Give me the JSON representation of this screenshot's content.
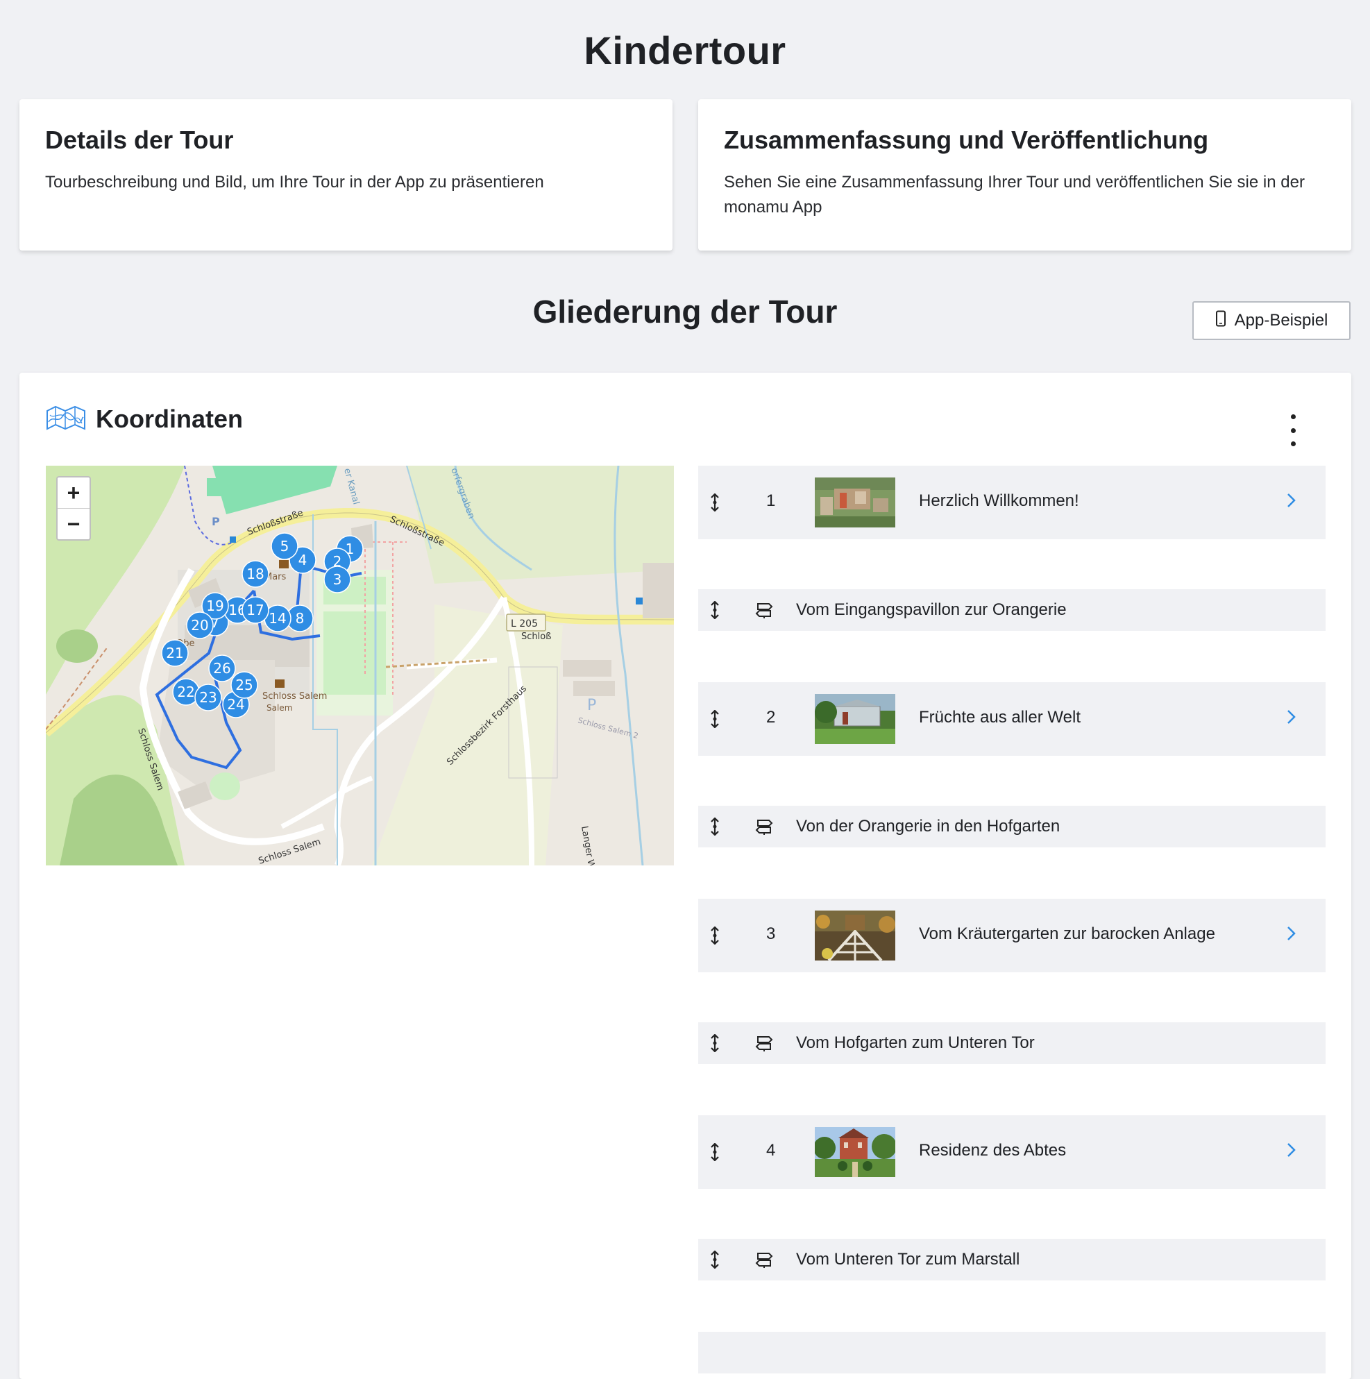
{
  "page": {
    "title": "Kindertour"
  },
  "cards": {
    "details": {
      "title": "Details der Tour",
      "description": "Tourbeschreibung und Bild, um Ihre Tour in der App zu präsentieren"
    },
    "summary": {
      "title": "Zusammenfassung und Veröffentlichung",
      "description": "Sehen Sie eine Zusammenfassung Ihrer Tour und veröffentlichen Sie sie in der monamu App"
    }
  },
  "outline": {
    "title": "Gliederung der Tour",
    "app_example_button": "App-Beispiel",
    "coordinates_title": "Koordinaten"
  },
  "map": {
    "zoom_in": "+",
    "zoom_out": "−",
    "street_labels": [
      "Schloßstraße",
      "Schloßstraße",
      "L 205",
      "Schloß",
      "Schlossbezirk Forsthaus",
      "Schloss Salem",
      "Schloss Salem",
      "Schloss Salem",
      "Langer W",
      "orfergraben",
      "er Kanal",
      "Mars",
      "Obe",
      "Schloss Salem 2"
    ],
    "markers": [
      "1",
      "2",
      "3",
      "4",
      "5",
      "7",
      "8",
      "14",
      "16",
      "17",
      "18",
      "19",
      "20",
      "21",
      "22",
      "23",
      "24",
      "25",
      "26"
    ]
  },
  "items": [
    {
      "type": "station",
      "number": "1",
      "title": "Herzlich Willkommen!",
      "thumb": "aerial-castle"
    },
    {
      "type": "route",
      "title": "Vom Eingangspavillon zur Orangerie"
    },
    {
      "type": "station",
      "number": "2",
      "title": "Früchte aus aller Welt",
      "thumb": "orangery-garden"
    },
    {
      "type": "route",
      "title": "Von der Orangerie in den Hofgarten"
    },
    {
      "type": "station",
      "number": "3",
      "title": "Vom Kräutergarten zur barocken Anlage",
      "thumb": "herb-garden"
    },
    {
      "type": "route",
      "title": "Vom Hofgarten zum Unteren Tor"
    },
    {
      "type": "station",
      "number": "4",
      "title": "Residenz des Abtes",
      "thumb": "abbot-residence"
    },
    {
      "type": "route",
      "title": "Vom Unteren Tor zum Marstall"
    }
  ],
  "colors": {
    "accent": "#2f8de4",
    "marker": "#2f8de4",
    "row_bg": "#f0f1f4",
    "page_bg": "#f0f1f4"
  }
}
